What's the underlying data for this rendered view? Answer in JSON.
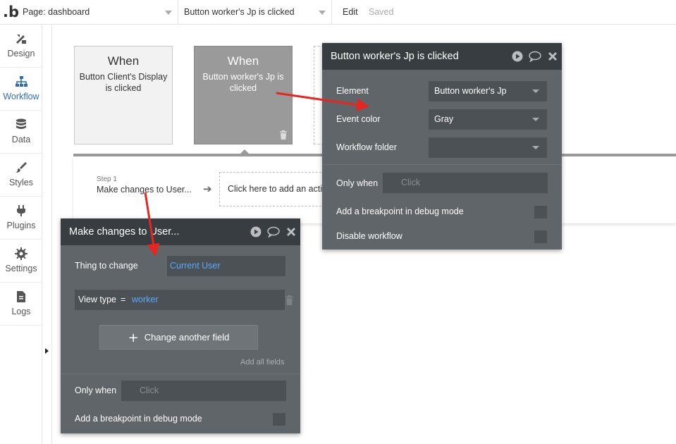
{
  "topbar": {
    "logo": ".b",
    "page_select": "Page: dashboard",
    "event_select": "Button worker's Jp is clicked",
    "edit": "Edit",
    "saved": "Saved"
  },
  "sidebar": {
    "items": [
      {
        "label": "Design",
        "icon": "design-icon"
      },
      {
        "label": "Workflow",
        "icon": "workflow-icon"
      },
      {
        "label": "Data",
        "icon": "data-icon"
      },
      {
        "label": "Styles",
        "icon": "styles-icon"
      },
      {
        "label": "Plugins",
        "icon": "plugins-icon"
      },
      {
        "label": "Settings",
        "icon": "settings-icon"
      },
      {
        "label": "Logs",
        "icon": "logs-icon"
      }
    ],
    "active": "Workflow"
  },
  "events": [
    {
      "when": "When",
      "description": "Button Client's Display is clicked"
    },
    {
      "when": "When",
      "description": "Button worker's Jp is clicked"
    }
  ],
  "step": {
    "number": "Step 1",
    "name": "Make changes to User...",
    "add_action": "Click here to add an action..."
  },
  "event_panel": {
    "title": "Button worker's Jp is clicked",
    "element_label": "Element",
    "element_value": "Button worker's Jp",
    "color_label": "Event color",
    "color_value": "Gray",
    "folder_label": "Workflow folder",
    "folder_value": "",
    "only_when_label": "Only when",
    "only_when_placeholder": "Click",
    "breakpoint_label": "Add a breakpoint in debug mode",
    "disable_label": "Disable workflow"
  },
  "action_panel": {
    "title": "Make changes to User...",
    "thing_label": "Thing to change",
    "thing_value": "Current User",
    "field_name": "View type",
    "field_eq": "=",
    "field_value": "worker",
    "change_button": "Change another field",
    "add_all": "Add all fields",
    "only_when_label": "Only when",
    "only_when_placeholder": "Click",
    "breakpoint_label": "Add a breakpoint in debug mode"
  },
  "colors": {
    "panel_bg": "#5f6568",
    "panel_header": "#373d40",
    "link": "#5aa9ff",
    "annotation_arrow": "#e8251f",
    "active_nav": "#2d6eb5"
  }
}
